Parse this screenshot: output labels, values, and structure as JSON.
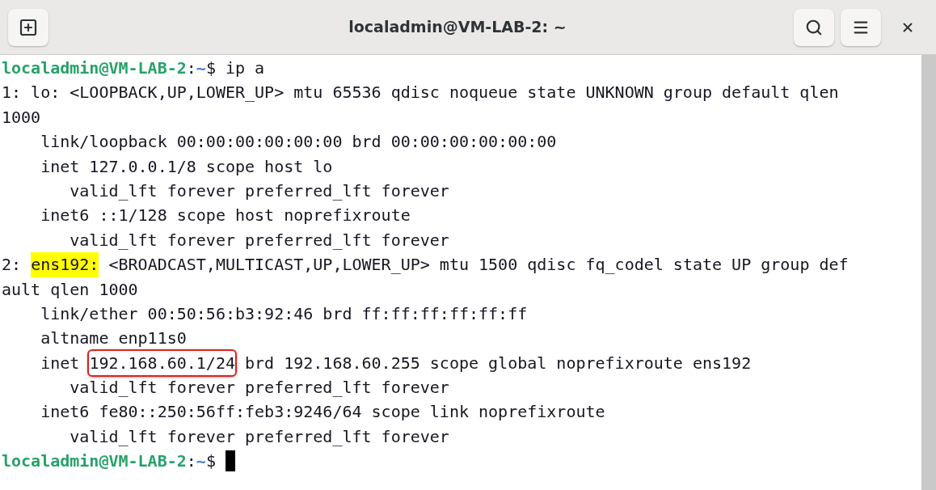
{
  "window": {
    "title": "localadmin@VM-LAB-2: ~"
  },
  "terminal": {
    "lines": [
      {
        "segments": [
          {
            "kind": "host",
            "text": "localadmin@VM-LAB-2"
          },
          {
            "kind": "plain",
            "text": ":"
          },
          {
            "kind": "path",
            "text": "~"
          },
          {
            "kind": "plain",
            "text": "$ ip a"
          }
        ]
      },
      {
        "segments": [
          {
            "kind": "plain",
            "text": "1: lo: <LOOPBACK,UP,LOWER_UP> mtu 65536 qdisc noqueue state UNKNOWN group default qlen"
          }
        ]
      },
      {
        "segments": [
          {
            "kind": "plain",
            "text": "1000"
          }
        ]
      },
      {
        "segments": [
          {
            "kind": "plain",
            "text": "    link/loopback 00:00:00:00:00:00 brd 00:00:00:00:00:00"
          }
        ]
      },
      {
        "segments": [
          {
            "kind": "plain",
            "text": "    inet 127.0.0.1/8 scope host lo"
          }
        ]
      },
      {
        "segments": [
          {
            "kind": "plain",
            "text": "       valid_lft forever preferred_lft forever"
          }
        ]
      },
      {
        "segments": [
          {
            "kind": "plain",
            "text": "    inet6 ::1/128 scope host noprefixroute"
          }
        ]
      },
      {
        "segments": [
          {
            "kind": "plain",
            "text": "       valid_lft forever preferred_lft forever"
          }
        ]
      },
      {
        "segments": [
          {
            "kind": "plain",
            "text": "2: "
          },
          {
            "kind": "highlight",
            "text": "ens192:"
          },
          {
            "kind": "plain",
            "text": " <BROADCAST,MULTICAST,UP,LOWER_UP> mtu 1500 qdisc fq_codel state UP group def"
          }
        ]
      },
      {
        "segments": [
          {
            "kind": "plain",
            "text": "ault qlen 1000"
          }
        ]
      },
      {
        "segments": [
          {
            "kind": "plain",
            "text": "    link/ether 00:50:56:b3:92:46 brd ff:ff:ff:ff:ff:ff"
          }
        ]
      },
      {
        "segments": [
          {
            "kind": "plain",
            "text": "    altname enp11s0"
          }
        ]
      },
      {
        "segments": [
          {
            "kind": "plain",
            "text": "    inet "
          },
          {
            "kind": "boxed",
            "text": "192.168.60.1/24"
          },
          {
            "kind": "plain",
            "text": " brd 192.168.60.255 scope global noprefixroute ens192"
          }
        ]
      },
      {
        "segments": [
          {
            "kind": "plain",
            "text": "       valid_lft forever preferred_lft forever"
          }
        ]
      },
      {
        "segments": [
          {
            "kind": "plain",
            "text": "    inet6 fe80::250:56ff:feb3:9246/64 scope link noprefixroute"
          }
        ]
      },
      {
        "segments": [
          {
            "kind": "plain",
            "text": "       valid_lft forever preferred_lft forever"
          }
        ]
      },
      {
        "segments": [
          {
            "kind": "host",
            "text": "localadmin@VM-LAB-2"
          },
          {
            "kind": "plain",
            "text": ":"
          },
          {
            "kind": "path",
            "text": "~"
          },
          {
            "kind": "plain",
            "text": "$ "
          }
        ],
        "cursor": true
      }
    ]
  }
}
